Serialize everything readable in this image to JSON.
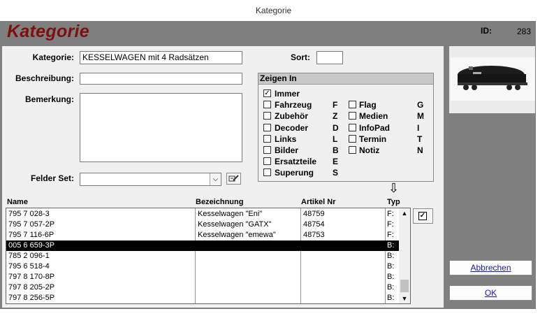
{
  "window": {
    "title": "Kategorie"
  },
  "header": {
    "heading": "Kategorie",
    "id_label": "ID:",
    "id_value": "283"
  },
  "form": {
    "kategorie_label": "Kategorie:",
    "kategorie_value": "KESSELWAGEN mit 4 Radsätzen",
    "sort_label": "Sort:",
    "sort_value": "",
    "beschreibung_label": "Beschreibung:",
    "beschreibung_value": "",
    "bemerkung_label": "Bemerkung:",
    "bemerkung_value": "",
    "felder_set_label": "Felder Set:",
    "felder_set_value": ""
  },
  "zeigen_in": {
    "title": "Zeigen In",
    "immer": {
      "label": "Immer",
      "checked": true
    },
    "left": [
      {
        "label": "Fahrzeug",
        "key": "F"
      },
      {
        "label": "Zubehör",
        "key": "Z"
      },
      {
        "label": "Decoder",
        "key": "D"
      },
      {
        "label": "Links",
        "key": "L"
      },
      {
        "label": "Bilder",
        "key": "B"
      },
      {
        "label": "Ersatzteile",
        "key": "E"
      },
      {
        "label": "Superung",
        "key": "S"
      }
    ],
    "right": [
      {
        "label": "Flag",
        "key": "G"
      },
      {
        "label": "Medien",
        "key": "M"
      },
      {
        "label": "InfoPad",
        "key": "I"
      },
      {
        "label": "Termin",
        "key": "T"
      },
      {
        "label": "Notiz",
        "key": "N"
      }
    ]
  },
  "table": {
    "headers": {
      "name": "Name",
      "bezeichnung": "Bezeichnung",
      "artikel": "Artikel Nr",
      "typ": "Typ"
    },
    "arrow": "⇩",
    "rows": [
      {
        "name": "795 7 028-3",
        "bezeichnung": "Kesselwagen \"Eni\"",
        "artikel": "48759",
        "typ": "F:"
      },
      {
        "name": "795 7 057-2P",
        "bezeichnung": "Kesselwagen \"GATX\"",
        "artikel": "48754",
        "typ": "F:"
      },
      {
        "name": "795 7 116-6P",
        "bezeichnung": "Kesselwagen \"emewa\"",
        "artikel": "48753",
        "typ": "F:"
      },
      {
        "name": "005 6 659-3P",
        "bezeichnung": "",
        "artikel": "",
        "typ": "B:",
        "selected": true
      },
      {
        "name": "785 2 096-1",
        "bezeichnung": "",
        "artikel": "",
        "typ": "B:"
      },
      {
        "name": "795 6 518-4",
        "bezeichnung": "",
        "artikel": "",
        "typ": "B:"
      },
      {
        "name": "797 8 170-8P",
        "bezeichnung": "",
        "artikel": "",
        "typ": "B:"
      },
      {
        "name": "797 8 205-2P",
        "bezeichnung": "",
        "artikel": "",
        "typ": "B:"
      },
      {
        "name": "797 8 256-5P",
        "bezeichnung": "",
        "artikel": "",
        "typ": "B:"
      }
    ]
  },
  "buttons": {
    "abbrechen": "Abbrechen",
    "ok": "OK"
  },
  "colors": {
    "frame": "#7f7f7f",
    "heading": "#7d0f0f",
    "form_bg": "#f0f0f0",
    "selected_row": "#000000"
  }
}
